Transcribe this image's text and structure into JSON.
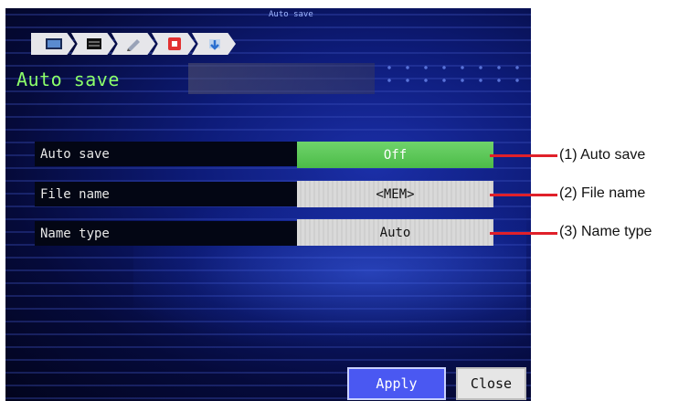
{
  "breadcrumb": {
    "caption": "Auto save",
    "icons": [
      "monitor-icon",
      "display-icon",
      "pencil-icon",
      "record-stop-icon",
      "auto-save-arrow-icon"
    ]
  },
  "title": "Auto save",
  "settings": [
    {
      "label": "Auto save",
      "value": "Off",
      "style": "green"
    },
    {
      "label": "File name",
      "value": "<MEM>",
      "style": "grey"
    },
    {
      "label": "Name type",
      "value": "Auto",
      "style": "grey"
    }
  ],
  "callouts": [
    "(1) Auto save",
    "(2) File name",
    "(3) Name type"
  ],
  "buttons": {
    "apply": "Apply",
    "close": "Close"
  },
  "colors": {
    "accent_green": "#4cbc48",
    "title_green": "#8cff6a",
    "apply_blue": "#4a58f2",
    "callout_red": "#e0202a"
  }
}
